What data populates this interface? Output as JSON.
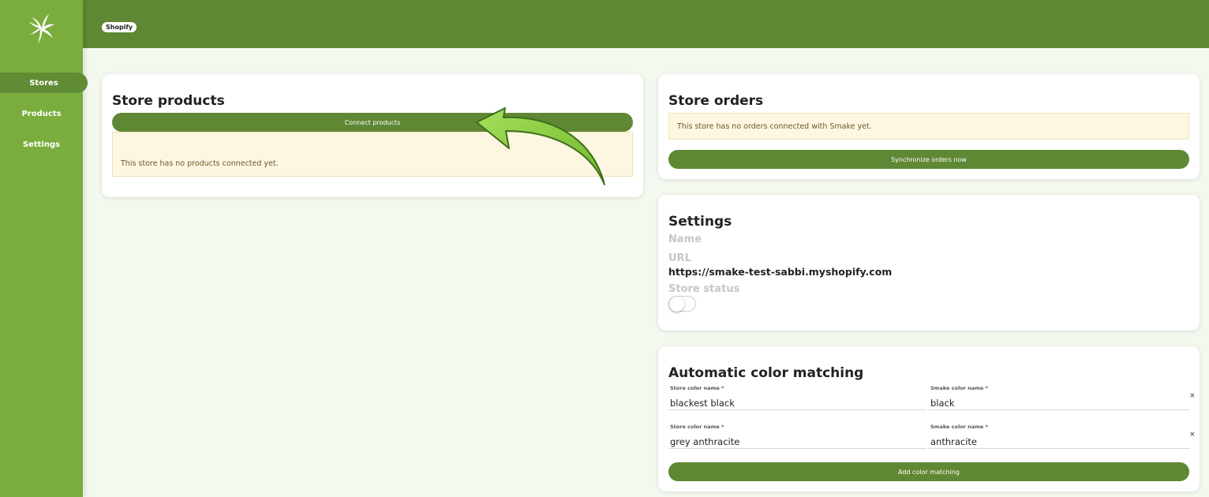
{
  "sidebar": {
    "items": [
      {
        "label": "Stores",
        "active": true
      },
      {
        "label": "Products",
        "active": false
      },
      {
        "label": "Settings",
        "active": false
      }
    ],
    "logo_icon": "spiral-logo-icon"
  },
  "header": {
    "store_badge": "Shopify"
  },
  "store_products": {
    "title": "Store products",
    "connect_button": "Connect products",
    "empty_notice": "This store has no products connected yet."
  },
  "store_orders": {
    "title": "Store orders",
    "empty_notice": "This store has no orders connected with Smake yet.",
    "sync_button": "Synchronize orders now"
  },
  "settings": {
    "title": "Settings",
    "name_label": "Name",
    "url_label": "URL",
    "url_value": "https://smake-test-sabbi.myshopify.com",
    "status_label": "Store status",
    "status_enabled": false
  },
  "color_matching": {
    "title": "Automatic color matching",
    "store_label": "Store color name *",
    "smake_label": "Smake color name *",
    "rows": [
      {
        "store_color": "blackest black",
        "smake_color": "black"
      },
      {
        "store_color": "grey anthracite",
        "smake_color": "anthracite"
      }
    ],
    "remove_symbol": "×",
    "add_button": "Add color matching"
  },
  "colors": {
    "sidebar": "#7aad3d",
    "header": "#5f8834",
    "button": "#5f8834",
    "notice_bg": "#fdf6e0",
    "arrow": "#7ec43a"
  }
}
